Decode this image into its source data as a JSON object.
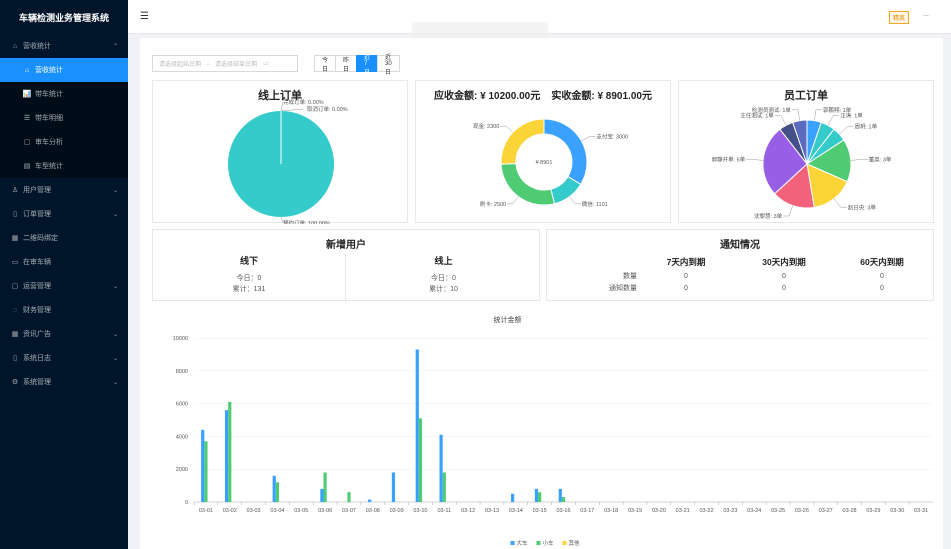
{
  "app": {
    "title": "车辆检测业务管理系统",
    "fold_icon": "menu-fold-icon"
  },
  "sidebar": {
    "items": [
      {
        "icon": "⌂",
        "label": "营收统计",
        "arrow": "⌃",
        "open": true,
        "children": [
          {
            "icon": "⌂",
            "label": "营收统计",
            "active": true
          },
          {
            "icon": "📊",
            "label": "带车统计"
          },
          {
            "icon": "☰",
            "label": "带车明细"
          },
          {
            "icon": "▢",
            "label": "审车分析"
          },
          {
            "icon": "▤",
            "label": "车型统计"
          }
        ]
      },
      {
        "icon": "♙",
        "label": "用户管理",
        "arrow": "⌄"
      },
      {
        "icon": "▯",
        "label": "订单管理",
        "arrow": "⌄"
      },
      {
        "icon": "▦",
        "label": "二维码绑定"
      },
      {
        "icon": "▭",
        "label": "在审车辆"
      },
      {
        "icon": "▢",
        "label": "运营管理",
        "arrow": "⌄"
      },
      {
        "icon": "◌",
        "label": "财务管理"
      },
      {
        "icon": "▦",
        "label": "资讯广告",
        "arrow": "⌄"
      },
      {
        "icon": "▯",
        "label": "系统日志",
        "arrow": "⌄"
      },
      {
        "icon": "⚙",
        "label": "系统管理",
        "arrow": "⌄"
      }
    ]
  },
  "header": {
    "badge": "精英",
    "user": "..."
  },
  "filter": {
    "start_placeholder": "请选择起始日期",
    "arrow": "→",
    "end_placeholder": "请选择结束日期",
    "calendar_icon": "calendar-icon",
    "tabs": [
      {
        "label": "今日"
      },
      {
        "label": "昨日"
      },
      {
        "label": "近7日",
        "active": true
      },
      {
        "label": "近30日"
      }
    ]
  },
  "online_orders": {
    "title": "线上订单",
    "slices": [
      {
        "label": "完成订单: 0.00%",
        "value": 0.0,
        "color": "#36cbcb"
      },
      {
        "label": "取消订单: 0.00%",
        "value": 0.0,
        "color": "#4ecb73"
      },
      {
        "label": "预约订单: 100.00%",
        "value": 100,
        "color": "#36cbcb"
      }
    ]
  },
  "amounts": {
    "title_receivable": "应收金额: ¥ 10200.00元",
    "title_received": "实收金额: ¥ 8901.00元",
    "center": "¥ 8901",
    "slices": [
      {
        "label": "支付宝: 3000",
        "value": 3000,
        "color": "#3aa1ff"
      },
      {
        "label": "微信: 1101",
        "value": 1101,
        "color": "#36cbcb"
      },
      {
        "label": "刷卡: 2500",
        "value": 2500,
        "color": "#4ecb73"
      },
      {
        "label": "现金: 2300",
        "value": 2300,
        "color": "#fbd437"
      }
    ]
  },
  "staff_orders": {
    "title": "员工订单",
    "slices": [
      {
        "label": "郭鹏翔: 1单",
        "value": 1,
        "color": "#3aa1ff"
      },
      {
        "label": "汪涛: 1单",
        "value": 1,
        "color": "#36cbcb"
      },
      {
        "label": "周玥: 1单",
        "value": 1,
        "color": "#36cbcb"
      },
      {
        "label": "董英: 3单",
        "value": 3,
        "color": "#4ecb73"
      },
      {
        "label": "赵日央: 3单",
        "value": 3,
        "color": "#fbd437"
      },
      {
        "label": "沈黎慧: 3单",
        "value": 3,
        "color": "#f2637b"
      },
      {
        "label": "郭静开单: 5单",
        "value": 5,
        "color": "#975fe5"
      },
      {
        "label": "主任测试: 1单",
        "value": 1,
        "color": "#435188"
      },
      {
        "label": "检测员测试: 1单",
        "value": 1,
        "color": "#5c6bc0"
      }
    ]
  },
  "new_users": {
    "title": "新增用户",
    "offline": {
      "title": "线下",
      "today": "今日：0",
      "total": "累计：131"
    },
    "online": {
      "title": "线上",
      "today": "今日：0",
      "total": "累计：10"
    }
  },
  "notifications": {
    "title": "通知情况",
    "headers": [
      "7天内到期",
      "30天内到期",
      "60天内到期"
    ],
    "rows": [
      {
        "label": "数量",
        "values": [
          "0",
          "0",
          "0"
        ]
      },
      {
        "label": "通知数量",
        "values": [
          "0",
          "0",
          "0"
        ]
      }
    ]
  },
  "chart_data": {
    "type": "bar",
    "title": "统计金额",
    "xlabel": "",
    "ylabel": "",
    "ylim": [
      0,
      10000
    ],
    "yticks": [
      0,
      2000,
      4000,
      6000,
      8000,
      10000
    ],
    "categories": [
      "03-01",
      "03-02",
      "03-03",
      "03-04",
      "03-05",
      "03-06",
      "03-07",
      "03-08",
      "03-09",
      "03-10",
      "03-11",
      "03-12",
      "03-13",
      "03-14",
      "03-15",
      "03-16",
      "03-17",
      "03-18",
      "03-19",
      "03-20",
      "03-21",
      "03-22",
      "03-23",
      "03-24",
      "03-25",
      "03-26",
      "03-27",
      "03-28",
      "03-29",
      "03-30",
      "03-31"
    ],
    "series": [
      {
        "name": "大车",
        "color": "#3aa1ff",
        "values": [
          4400,
          5600,
          0,
          1600,
          0,
          800,
          0,
          150,
          1800,
          9300,
          4100,
          0,
          0,
          500,
          800,
          800,
          0,
          0,
          0,
          0,
          0,
          0,
          0,
          0,
          0,
          0,
          0,
          0,
          0,
          0,
          0
        ]
      },
      {
        "name": "小车",
        "color": "#4ecb73",
        "values": [
          3700,
          6100,
          0,
          1200,
          0,
          1800,
          600,
          0,
          0,
          5100,
          1800,
          0,
          0,
          0,
          600,
          300,
          0,
          0,
          0,
          0,
          0,
          0,
          0,
          0,
          0,
          0,
          0,
          0,
          0,
          0,
          0
        ]
      },
      {
        "name": "其他",
        "color": "#fbd437",
        "values": [
          0,
          0,
          0,
          0,
          0,
          0,
          0,
          0,
          0,
          0,
          0,
          0,
          0,
          0,
          0,
          0,
          0,
          0,
          0,
          0,
          0,
          0,
          0,
          0,
          0,
          0,
          0,
          0,
          0,
          0,
          0
        ]
      }
    ],
    "legend_position": "bottom",
    "grid": true
  }
}
